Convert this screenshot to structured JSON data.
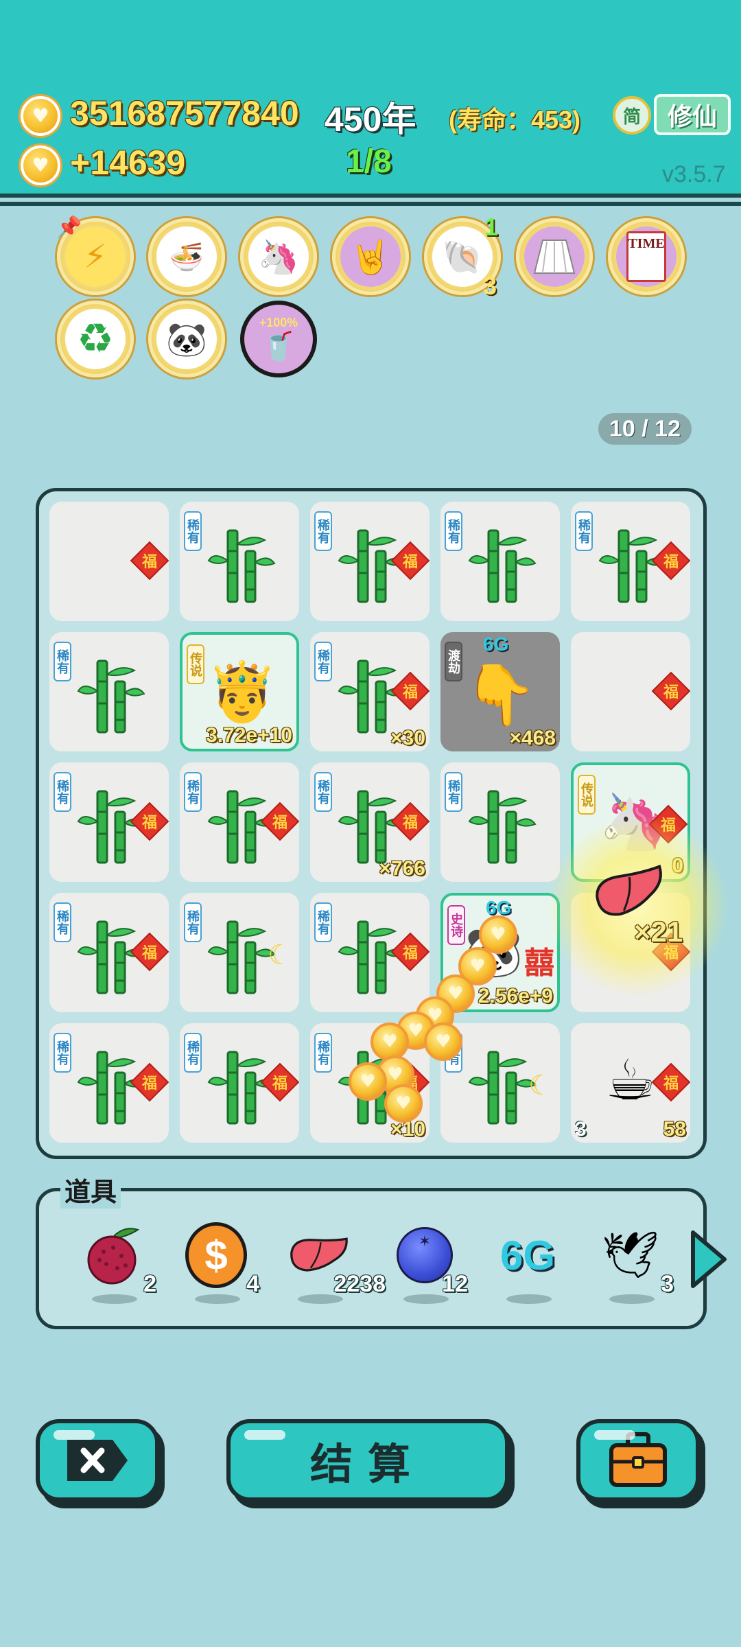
{
  "header": {
    "money": "351687577840",
    "year": "450年",
    "lifespan": "(寿命：453)",
    "income": "+14639",
    "progress": "1/8",
    "lang_button": "简",
    "cultivate_button": "修仙",
    "version": "v3.5.7"
  },
  "buffs": [
    {
      "name": "lightning-buff"
    },
    {
      "name": "noodle-bowls-buff"
    },
    {
      "name": "unicorn-buff"
    },
    {
      "name": "rock-hand-buff"
    },
    {
      "name": "shell-buff",
      "top_count": "1",
      "bottom_count": "3"
    },
    {
      "name": "skirt-buff"
    },
    {
      "name": "time-card-buff"
    },
    {
      "name": "recycle-buff"
    },
    {
      "name": "panda-buff"
    },
    {
      "name": "milk-tea-buff",
      "badge": "+100%"
    }
  ],
  "page_indicator": "10 / 12",
  "rarity_labels": {
    "rare": "稀有",
    "legend": "传说",
    "trial": "渡劫",
    "epic": "史诗"
  },
  "fu": "福",
  "grid": {
    "r2c2_count": "3.72e+10",
    "r2c3_count": "×30",
    "r2c4_tag": "6G",
    "r2c4_count": "×468",
    "r3c3_count": "×766",
    "r3c5_count": "0",
    "r4c4_tag": "6G",
    "r4c4_count": "2.56e+9",
    "r4c4_xi": "囍",
    "r5c3_count": "×10",
    "r5c5_left": "3",
    "r5c5_count": "58",
    "fly_count": "×21"
  },
  "tools": {
    "title": "道具",
    "items": [
      {
        "name": "lychee",
        "count": "2"
      },
      {
        "name": "dollar-coin",
        "count": "4"
      },
      {
        "name": "liver",
        "count": "2238"
      },
      {
        "name": "blueberry",
        "count": "12"
      },
      {
        "name": "6g",
        "label": "6G",
        "count": ""
      },
      {
        "name": "dove",
        "count": "3"
      }
    ]
  },
  "buttons": {
    "settle": "结算"
  }
}
